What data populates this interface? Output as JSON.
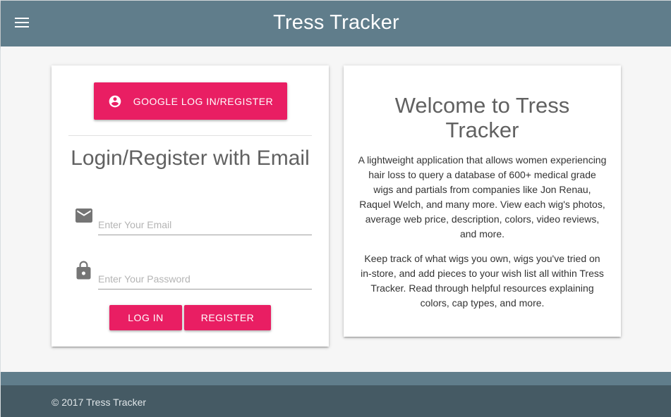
{
  "header": {
    "title": "Tress Tracker",
    "menu_icon": "menu-icon"
  },
  "login_card": {
    "google_button_label": "GOOGLE LOG IN/REGISTER",
    "google_icon": "account-circle-icon",
    "heading": "Login/Register with Email",
    "email_icon": "email-icon",
    "email_placeholder": "Enter Your Email",
    "email_value": "",
    "password_icon": "lock-icon",
    "password_placeholder": "Enter Your Password",
    "password_value": "",
    "login_label": "LOG IN",
    "register_label": "REGISTER"
  },
  "welcome_card": {
    "heading": "Welcome to Tress Tracker",
    "paragraph_1": "A lightweight application that allows women experiencing hair loss to query a database of 600+ medical grade wigs and partials from companies like Jon Renau, Raquel Welch, and many more. View each wig's photos, average web price, description, colors, video reviews, and more.",
    "paragraph_2": "Keep track of what wigs you own, wigs you've tried on in-store, and add pieces to your wish list all within Tress Tracker. Read through helpful resources explaining colors, cap types, and more."
  },
  "footer": {
    "copyright": "© 2017 Tress Tracker"
  },
  "colors": {
    "header": "#607d8b",
    "footer": "#455a64",
    "accent": "#e91e63",
    "background": "#f6f6f6"
  }
}
